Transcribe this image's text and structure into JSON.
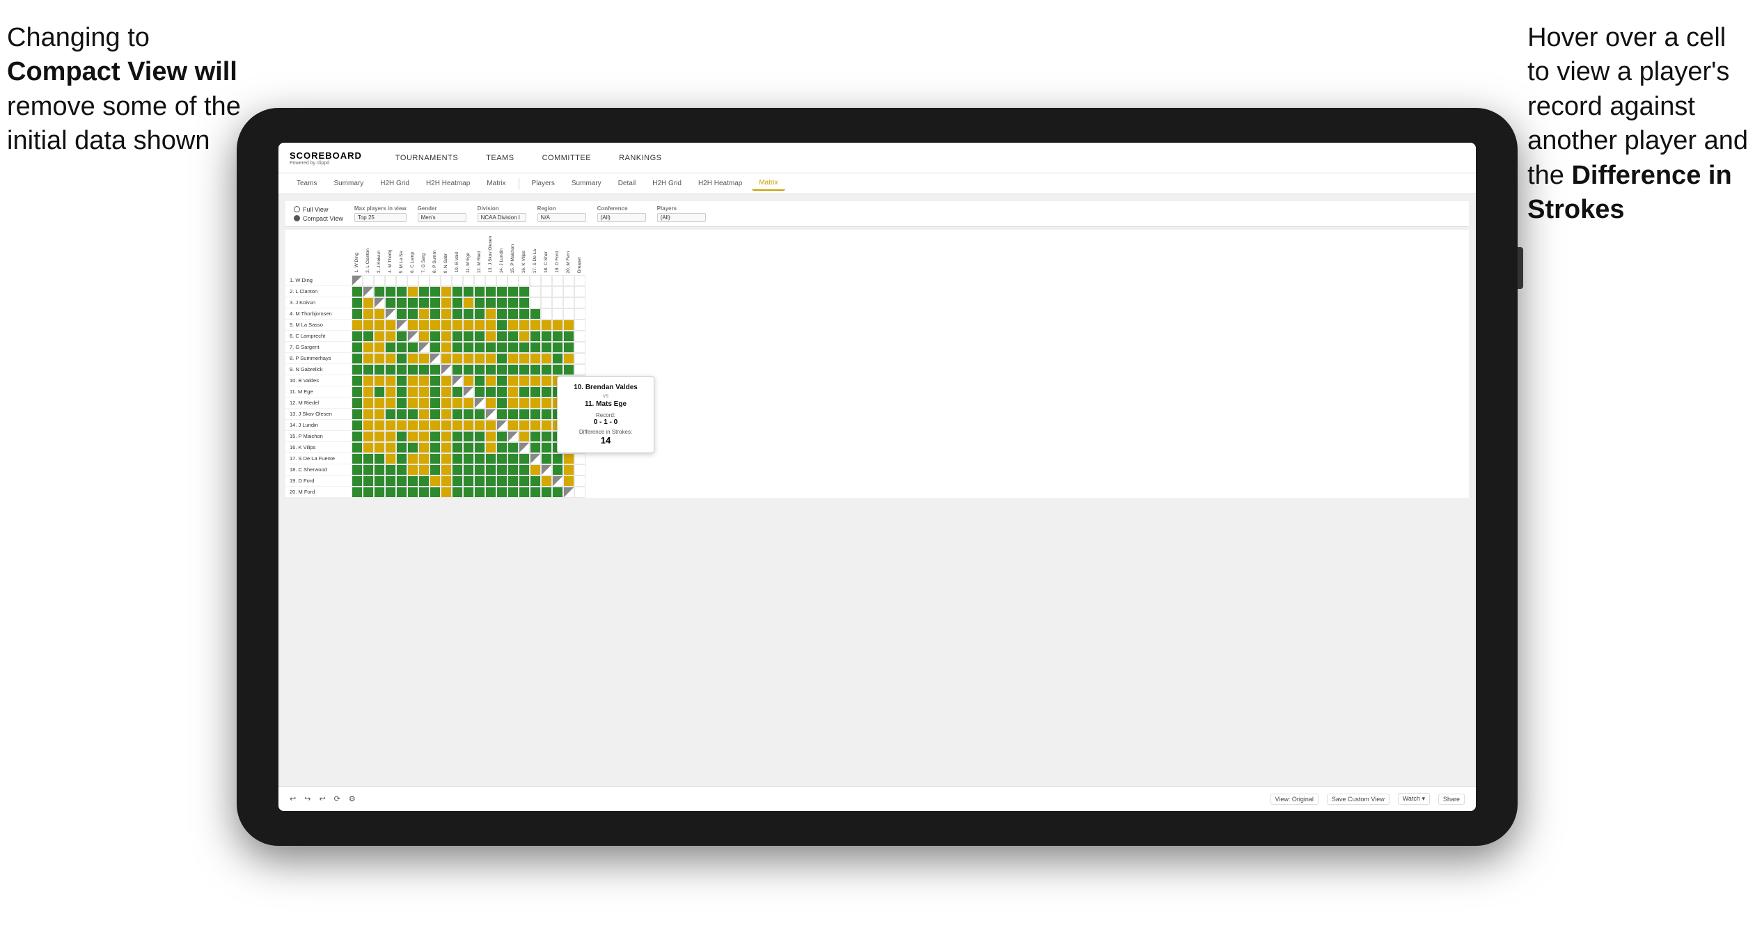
{
  "annotations": {
    "left": {
      "line1": "Changing to",
      "line2": "Compact View will",
      "line3": "remove some of the",
      "line4": "initial data shown"
    },
    "right": {
      "line1": "Hover over a cell",
      "line2": "to view a player's",
      "line3": "record against",
      "line4": "another player and",
      "line5": "the ",
      "line5bold": "Difference in",
      "line6bold": "Strokes"
    }
  },
  "app": {
    "logo": "SCOREBOARD",
    "logo_sub": "Powered by clippd",
    "nav": [
      "TOURNAMENTS",
      "TEAMS",
      "COMMITTEE",
      "RANKINGS"
    ]
  },
  "subnav": {
    "left_tabs": [
      "Teams",
      "Summary",
      "H2H Grid",
      "H2H Heatmap",
      "Matrix"
    ],
    "right_tabs": [
      "Players",
      "Summary",
      "Detail",
      "H2H Grid",
      "H2H Heatmap",
      "Matrix"
    ],
    "active": "Matrix"
  },
  "controls": {
    "view_options": [
      "Full View",
      "Compact View"
    ],
    "selected_view": "Compact View",
    "max_players_label": "Max players in view",
    "max_players_value": "Top 25",
    "gender_label": "Gender",
    "gender_value": "Men's",
    "division_label": "Division",
    "division_value": "NCAA Division I",
    "region_label": "Region",
    "region_value": "N/A",
    "conference_label": "Conference",
    "conference_value": "(All)",
    "players_label": "Players",
    "players_value": "(All)"
  },
  "players": [
    "1. W Ding",
    "2. L Clanton",
    "3. J Koivun",
    "4. M Thorbjornsen",
    "5. M La Sasso",
    "6. C Lamprecht",
    "7. G Sargent",
    "8. P Summerhays",
    "9. N Gabrelick",
    "10. B Valdes",
    "11. M Ege",
    "12. M Riedel",
    "13. J Skov Olesen",
    "14. J Lundin",
    "15. P Maichon",
    "16. K Vilips",
    "17. S De La Fuente",
    "18. C Sherwood",
    "19. D Ford",
    "20. M Ford"
  ],
  "col_headers": [
    "1. W Ding",
    "2. L Clanton",
    "3. J Koivun",
    "4. M Thorbj",
    "5. M La Sa",
    "6. C Lamp",
    "7. G Sarg",
    "8. P Summ",
    "9. N Gabr",
    "10. B Vald",
    "11. M Ege",
    "12. M Ried",
    "13. J Skov Olesen",
    "14. J Lundin",
    "15. P Maichon",
    "16. K Vilips",
    "17. S De La",
    "18. C Sher",
    "19. D Ford",
    "20. M Fern",
    "Greaser"
  ],
  "tooltip": {
    "player1": "10. Brendan Valdes",
    "vs": "vs",
    "player2": "11. Mats Ege",
    "record_label": "Record:",
    "record": "0 - 1 - 0",
    "diff_label": "Difference in Strokes:",
    "diff": "14"
  },
  "toolbar": {
    "undo": "↩",
    "view_original": "View: Original",
    "save_custom": "Save Custom View",
    "watch": "Watch ▾",
    "share": "Share"
  }
}
